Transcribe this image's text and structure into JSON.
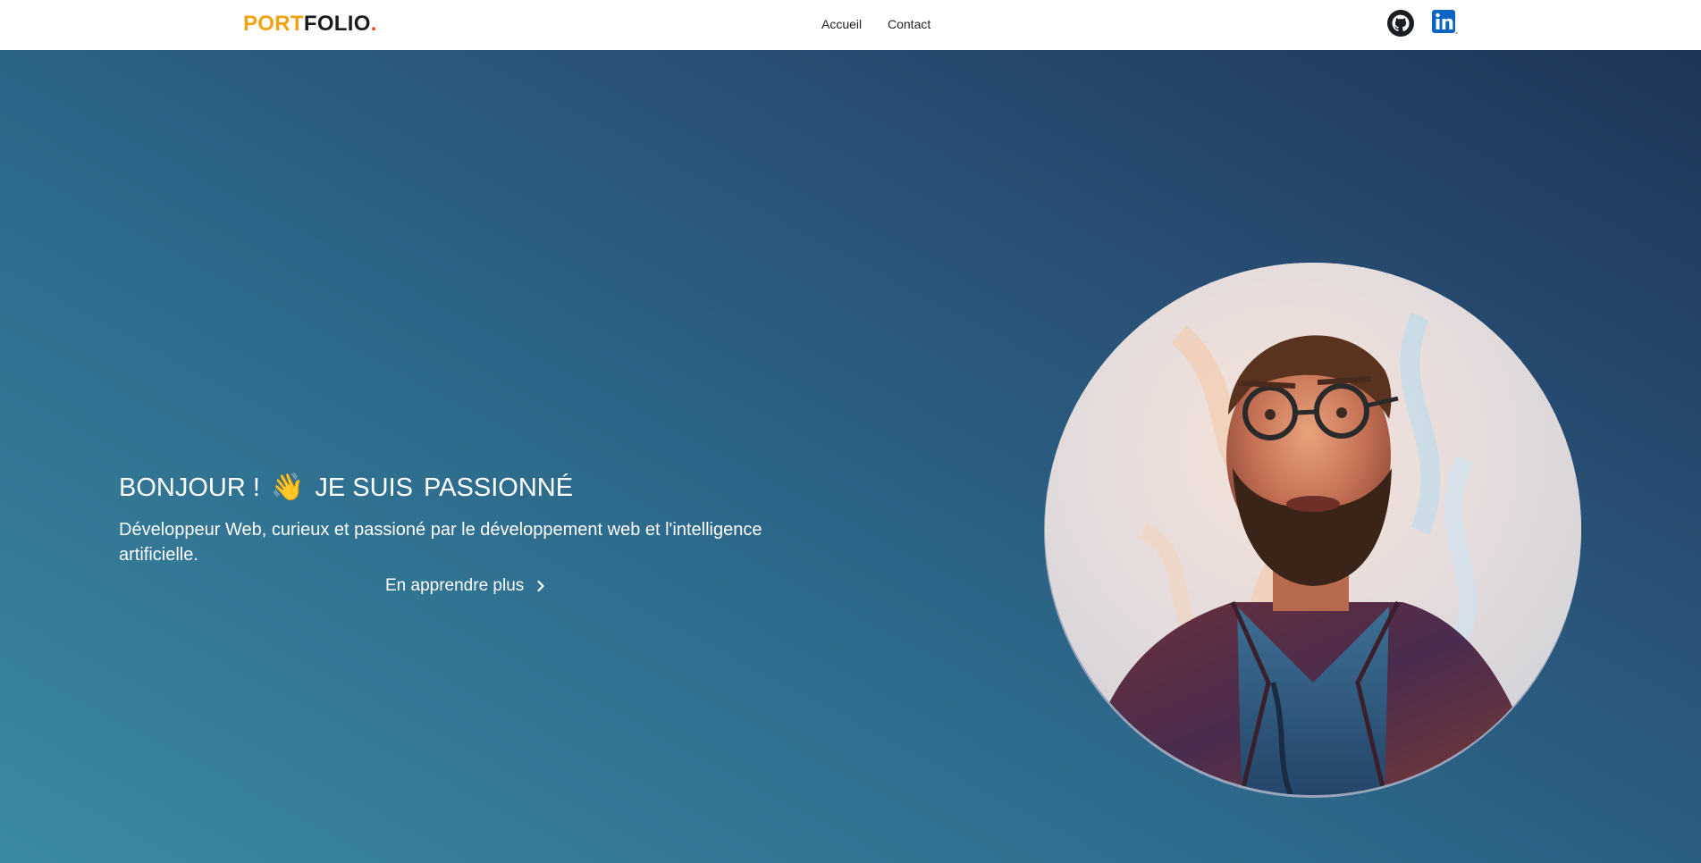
{
  "header": {
    "logo": {
      "part1": "PORT",
      "part2": "FOLIO",
      "dot": "."
    },
    "nav": [
      {
        "label": "Accueil"
      },
      {
        "label": "Contact"
      }
    ],
    "social": [
      {
        "icon": "github-icon"
      },
      {
        "icon": "linkedin-icon"
      }
    ]
  },
  "hero": {
    "title_prefix": "BONJOUR !",
    "title_emoji": "👋",
    "title_suffix": "JE SUIS",
    "title_word": "PASSIONNÉ",
    "description": "Développeur Web, curieux et passioné par le développement web et l'intelligence artificielle.",
    "cta_label": "En apprendre plus",
    "cta_icon": "chevron-right-icon",
    "portrait_icon": "profile-portrait"
  },
  "colors": {
    "logo_orange": "#f2a30f",
    "logo_dark": "#1b1b1b",
    "logo_dot": "#e8461e",
    "hero_gradient_light": "#3a8aa2",
    "hero_gradient_dark": "#1f3559",
    "linkedin_blue": "#0a66c2"
  }
}
